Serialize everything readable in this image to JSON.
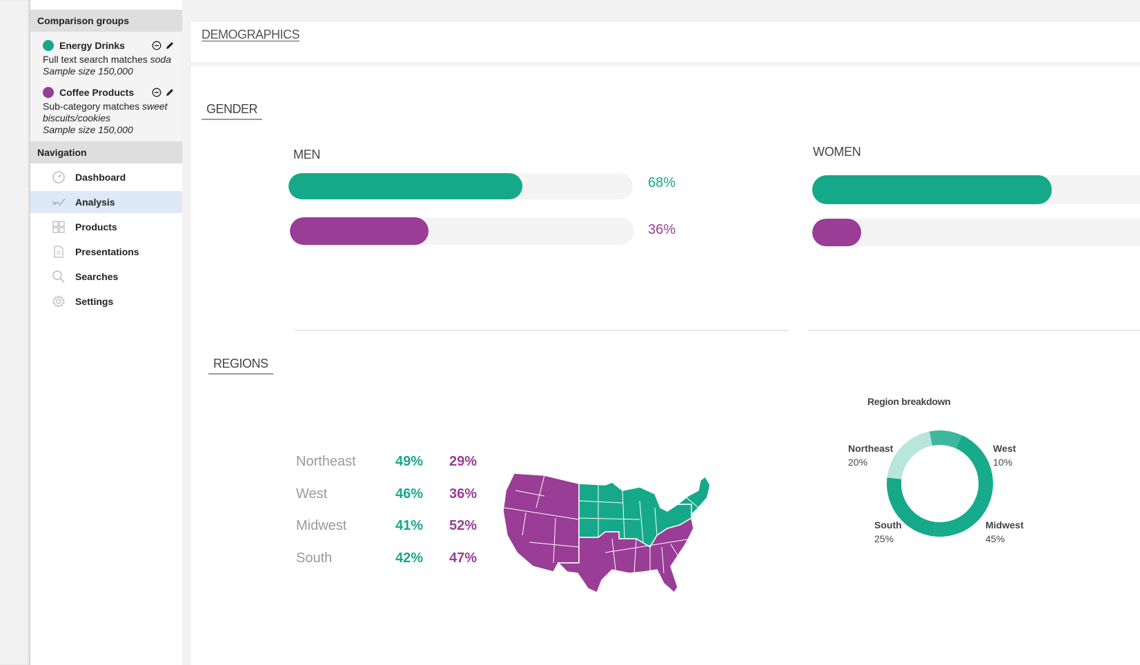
{
  "colors": {
    "group1": "#15a98a",
    "group2": "#993d96",
    "track": "#f4f4f4",
    "donut_northeast": "#b9e6da",
    "donut_west": "#3eb89c",
    "donut_midwest": "#17ab8c",
    "donut_south": "#15a98a"
  },
  "sidebar": {
    "comparison_title": "Comparison groups",
    "groups": [
      {
        "name": "Energy Drinks",
        "color": "#15a98a",
        "criteria_prefix": "Full text search matches ",
        "criteria_value": "soda",
        "sample": "Sample size 150,000"
      },
      {
        "name": "Coffee Products",
        "color": "#993d96",
        "criteria_prefix": "Sub-category matches ",
        "criteria_value": "sweet biscuits/cookies",
        "sample": "Sample size 150,000"
      }
    ],
    "navigation_title": "Navigation",
    "nav": [
      {
        "label": "Dashboard",
        "icon": "dashboard-icon",
        "active": false
      },
      {
        "label": "Analysis",
        "icon": "analysis-icon",
        "active": true
      },
      {
        "label": "Products",
        "icon": "products-icon",
        "active": false
      },
      {
        "label": "Presentations",
        "icon": "presentations-icon",
        "active": false
      },
      {
        "label": "Searches",
        "icon": "search-icon",
        "active": false
      },
      {
        "label": "Settings",
        "icon": "settings-icon",
        "active": false
      }
    ]
  },
  "main": {
    "title": "DEMOGRAPHICS",
    "gender": {
      "title": "GENDER",
      "men": {
        "label": "MEN",
        "group1_value": 68,
        "group1_text": "68%",
        "group2_value": 36,
        "group2_text": "36%"
      },
      "women": {
        "label": "WOMEN",
        "group1_fill_fraction": 0.73,
        "group2_fill_fraction": 0.15
      }
    },
    "regions": {
      "title": "REGIONS",
      "rows": [
        {
          "name": "Northeast",
          "g1": "49%",
          "g2": "29%"
        },
        {
          "name": "West",
          "g1": "46%",
          "g2": "36%"
        },
        {
          "name": "Midwest",
          "g1": "41%",
          "g2": "52%"
        },
        {
          "name": "South",
          "g1": "42%",
          "g2": "47%"
        }
      ],
      "map": {
        "group1_regions": [
          "Midwest",
          "Northeast"
        ],
        "group2_regions": [
          "West",
          "South"
        ]
      }
    },
    "breakdown": {
      "title": "Region breakdown",
      "slices": [
        {
          "name": "Northeast",
          "value": 20,
          "text": "20%"
        },
        {
          "name": "West",
          "value": 10,
          "text": "10%"
        },
        {
          "name": "Midwest",
          "value": 45,
          "text": "45%"
        },
        {
          "name": "South",
          "value": 25,
          "text": "25%"
        }
      ]
    }
  },
  "chart_data": [
    {
      "type": "bar",
      "title": "MEN",
      "categories": [
        "Energy Drinks",
        "Coffee Products"
      ],
      "values": [
        68,
        36
      ],
      "ylim": [
        0,
        100
      ]
    },
    {
      "type": "pie",
      "title": "Region breakdown",
      "categories": [
        "Northeast",
        "West",
        "Midwest",
        "South"
      ],
      "values": [
        20,
        10,
        45,
        25
      ]
    }
  ]
}
